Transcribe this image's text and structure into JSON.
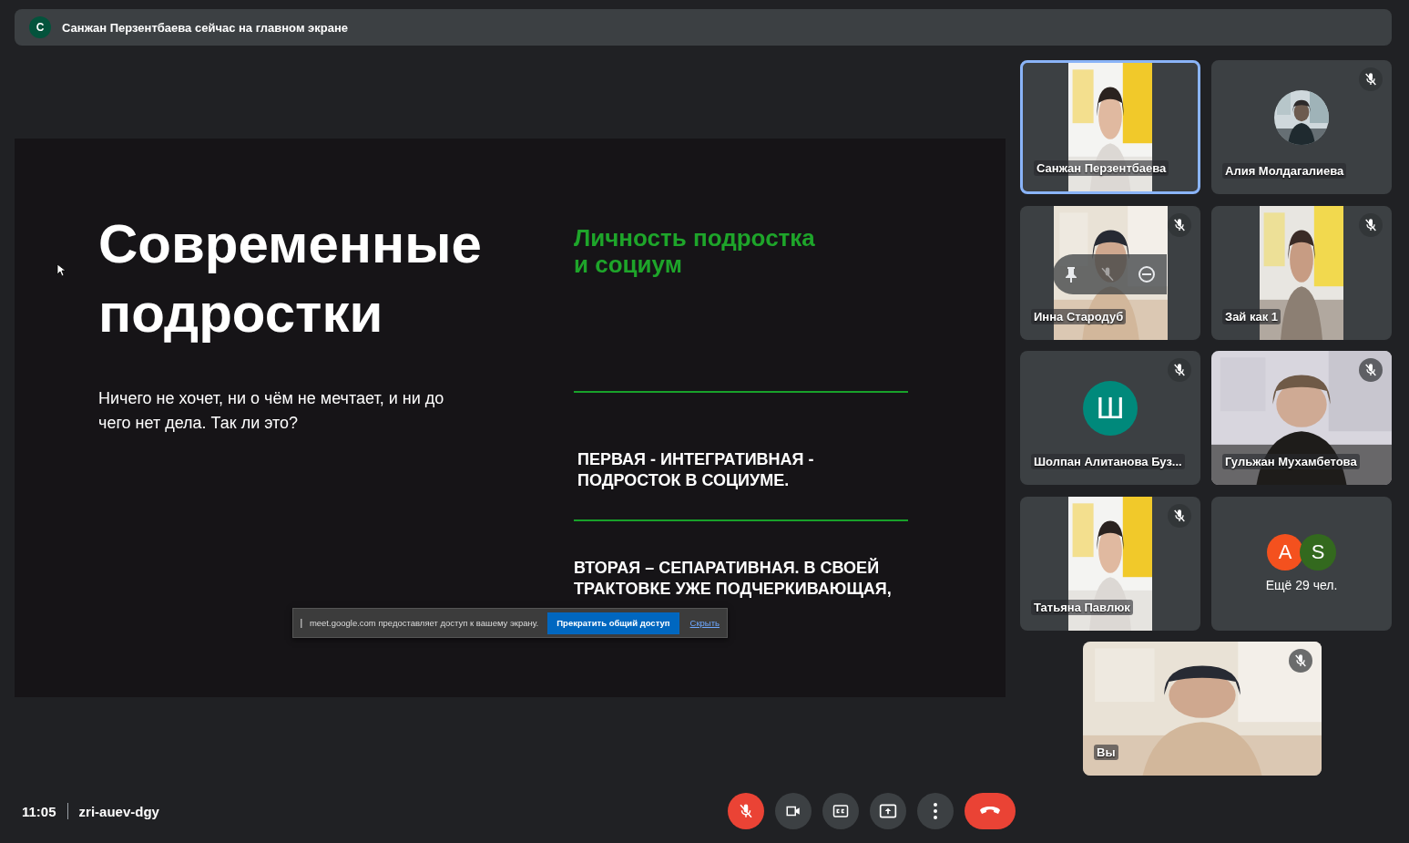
{
  "banner": {
    "avatar_letter": "С",
    "text": "Санжан Перзентбаева сейчас на главном экране"
  },
  "slide": {
    "title": "Современные подростки",
    "subtitle": "Ничего не хочет, ни о чём не мечтает, и ни до чего нет дела. Так ли это?",
    "heading": "Личность подростка и социум",
    "points": [
      "ПЕРВАЯ - ИНТЕГРАТИВНАЯ - ПОДРОСТОК В СОЦИУМЕ.",
      "ВТОРАЯ – СЕПАРАТИВНАЯ. В СВОЕЙ ТРАКТОВКЕ УЖЕ ПОДЧЕРКИВАЮЩАЯ,"
    ]
  },
  "share_bar": {
    "message": "meet.google.com предоставляет доступ к вашему экрану.",
    "stop_button": "Прекратить общий доступ",
    "hide_link": "Скрыть"
  },
  "tiles": [
    {
      "kind": "narrow-video",
      "name": "Санжан Перзентбаева",
      "speaking": true,
      "hover_controls": false
    },
    {
      "kind": "photo-avatar",
      "name": "Алия Молдагалиева",
      "muted": true,
      "speaking": false,
      "hover_controls": false
    },
    {
      "kind": "portrait-video",
      "name": "Инна Стародуб",
      "muted": true,
      "speaking": false,
      "hover_controls": true
    },
    {
      "kind": "narrow-video",
      "name": "Зай как 1",
      "muted": true,
      "speaking": false,
      "hover_controls": false
    },
    {
      "kind": "letter-avatar",
      "name": "Шолпан Алитанова Буз...",
      "letter": "Ш",
      "color": "#00897b",
      "muted": true,
      "speaking": false,
      "hover_controls": false
    },
    {
      "kind": "video",
      "name": "Гульжан Мухамбетова",
      "muted": true,
      "speaking": false,
      "hover_controls": false
    },
    {
      "kind": "narrow-video",
      "name": "Татьяна Павлюк",
      "muted": true,
      "speaking": false,
      "hover_controls": false
    },
    {
      "kind": "overflow",
      "label": "Ещё 29 чел.",
      "avatars": [
        {
          "letter": "A",
          "color": "#f4511e"
        },
        {
          "letter": "S",
          "color": "#33691e"
        }
      ]
    },
    {
      "kind": "video",
      "name": "Вы",
      "muted": true,
      "speaking": false,
      "hover_controls": false
    }
  ],
  "bottom_bar": {
    "time": "11:05",
    "meeting_code": "zri-auev-dgy",
    "controls": [
      {
        "kind": "mic",
        "off": true
      },
      {
        "kind": "camera",
        "off": false
      },
      {
        "kind": "captions",
        "off": false
      },
      {
        "kind": "present",
        "off": false
      },
      {
        "kind": "more",
        "off": false
      },
      {
        "kind": "leave"
      }
    ]
  }
}
